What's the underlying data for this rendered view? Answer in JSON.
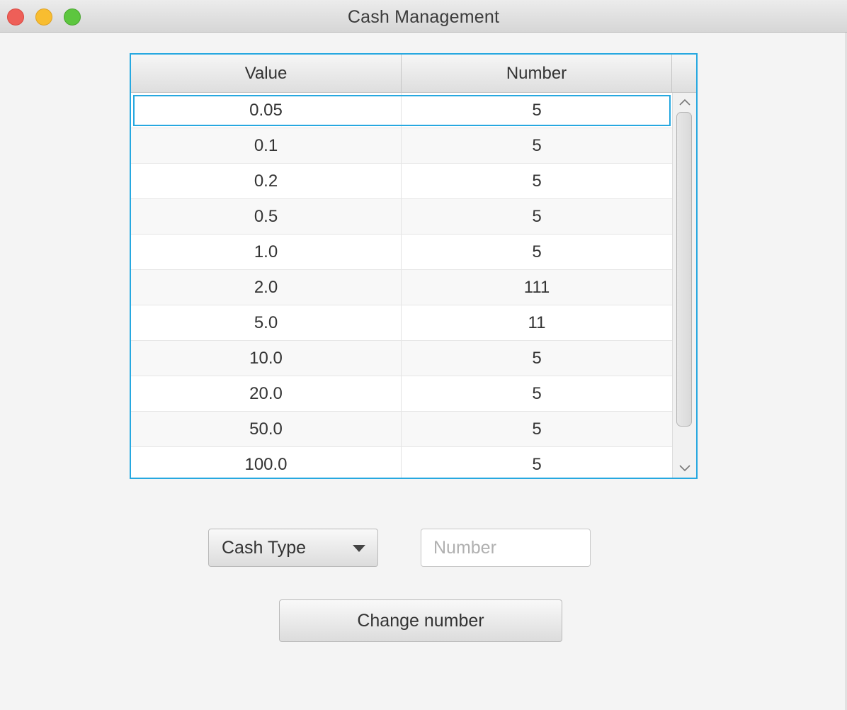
{
  "window": {
    "title": "Cash Management"
  },
  "table": {
    "columns": [
      "Value",
      "Number"
    ],
    "rows": [
      {
        "value": "0.05",
        "number": "5"
      },
      {
        "value": "0.1",
        "number": "5"
      },
      {
        "value": "0.2",
        "number": "5"
      },
      {
        "value": "0.5",
        "number": "5"
      },
      {
        "value": "1.0",
        "number": "5"
      },
      {
        "value": "2.0",
        "number": "111"
      },
      {
        "value": "5.0",
        "number": "11"
      },
      {
        "value": "10.0",
        "number": "5"
      },
      {
        "value": "20.0",
        "number": "5"
      },
      {
        "value": "50.0",
        "number": "5"
      },
      {
        "value": "100.0",
        "number": "5"
      }
    ]
  },
  "controls": {
    "cash_type_label": "Cash Type",
    "number_placeholder": "Number",
    "number_value": "",
    "change_button_label": "Change number"
  },
  "icons": {
    "scroll_up": "chevron-up-icon",
    "scroll_down": "chevron-down-icon",
    "dropdown": "triangle-down-icon"
  },
  "colors": {
    "focus": "#27a8e0",
    "close": "#ee5f58",
    "minimize": "#f8bd30",
    "maximize": "#5dc63f"
  }
}
